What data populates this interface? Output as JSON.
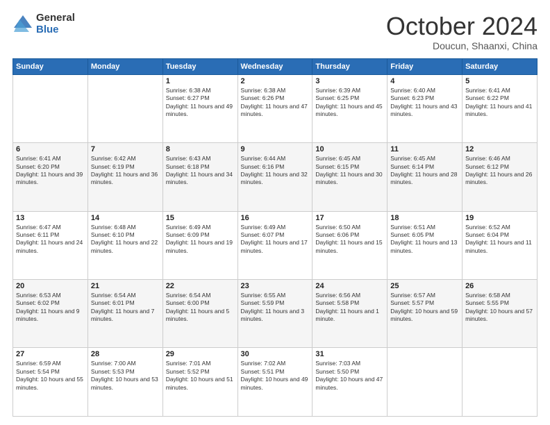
{
  "logo": {
    "general": "General",
    "blue": "Blue"
  },
  "header": {
    "month": "October 2024",
    "location": "Doucun, Shaanxi, China"
  },
  "weekdays": [
    "Sunday",
    "Monday",
    "Tuesday",
    "Wednesday",
    "Thursday",
    "Friday",
    "Saturday"
  ],
  "weeks": [
    [
      {
        "day": "",
        "sunrise": "",
        "sunset": "",
        "daylight": ""
      },
      {
        "day": "",
        "sunrise": "",
        "sunset": "",
        "daylight": ""
      },
      {
        "day": "1",
        "sunrise": "Sunrise: 6:38 AM",
        "sunset": "Sunset: 6:27 PM",
        "daylight": "Daylight: 11 hours and 49 minutes."
      },
      {
        "day": "2",
        "sunrise": "Sunrise: 6:38 AM",
        "sunset": "Sunset: 6:26 PM",
        "daylight": "Daylight: 11 hours and 47 minutes."
      },
      {
        "day": "3",
        "sunrise": "Sunrise: 6:39 AM",
        "sunset": "Sunset: 6:25 PM",
        "daylight": "Daylight: 11 hours and 45 minutes."
      },
      {
        "day": "4",
        "sunrise": "Sunrise: 6:40 AM",
        "sunset": "Sunset: 6:23 PM",
        "daylight": "Daylight: 11 hours and 43 minutes."
      },
      {
        "day": "5",
        "sunrise": "Sunrise: 6:41 AM",
        "sunset": "Sunset: 6:22 PM",
        "daylight": "Daylight: 11 hours and 41 minutes."
      }
    ],
    [
      {
        "day": "6",
        "sunrise": "Sunrise: 6:41 AM",
        "sunset": "Sunset: 6:20 PM",
        "daylight": "Daylight: 11 hours and 39 minutes."
      },
      {
        "day": "7",
        "sunrise": "Sunrise: 6:42 AM",
        "sunset": "Sunset: 6:19 PM",
        "daylight": "Daylight: 11 hours and 36 minutes."
      },
      {
        "day": "8",
        "sunrise": "Sunrise: 6:43 AM",
        "sunset": "Sunset: 6:18 PM",
        "daylight": "Daylight: 11 hours and 34 minutes."
      },
      {
        "day": "9",
        "sunrise": "Sunrise: 6:44 AM",
        "sunset": "Sunset: 6:16 PM",
        "daylight": "Daylight: 11 hours and 32 minutes."
      },
      {
        "day": "10",
        "sunrise": "Sunrise: 6:45 AM",
        "sunset": "Sunset: 6:15 PM",
        "daylight": "Daylight: 11 hours and 30 minutes."
      },
      {
        "day": "11",
        "sunrise": "Sunrise: 6:45 AM",
        "sunset": "Sunset: 6:14 PM",
        "daylight": "Daylight: 11 hours and 28 minutes."
      },
      {
        "day": "12",
        "sunrise": "Sunrise: 6:46 AM",
        "sunset": "Sunset: 6:12 PM",
        "daylight": "Daylight: 11 hours and 26 minutes."
      }
    ],
    [
      {
        "day": "13",
        "sunrise": "Sunrise: 6:47 AM",
        "sunset": "Sunset: 6:11 PM",
        "daylight": "Daylight: 11 hours and 24 minutes."
      },
      {
        "day": "14",
        "sunrise": "Sunrise: 6:48 AM",
        "sunset": "Sunset: 6:10 PM",
        "daylight": "Daylight: 11 hours and 22 minutes."
      },
      {
        "day": "15",
        "sunrise": "Sunrise: 6:49 AM",
        "sunset": "Sunset: 6:09 PM",
        "daylight": "Daylight: 11 hours and 19 minutes."
      },
      {
        "day": "16",
        "sunrise": "Sunrise: 6:49 AM",
        "sunset": "Sunset: 6:07 PM",
        "daylight": "Daylight: 11 hours and 17 minutes."
      },
      {
        "day": "17",
        "sunrise": "Sunrise: 6:50 AM",
        "sunset": "Sunset: 6:06 PM",
        "daylight": "Daylight: 11 hours and 15 minutes."
      },
      {
        "day": "18",
        "sunrise": "Sunrise: 6:51 AM",
        "sunset": "Sunset: 6:05 PM",
        "daylight": "Daylight: 11 hours and 13 minutes."
      },
      {
        "day": "19",
        "sunrise": "Sunrise: 6:52 AM",
        "sunset": "Sunset: 6:04 PM",
        "daylight": "Daylight: 11 hours and 11 minutes."
      }
    ],
    [
      {
        "day": "20",
        "sunrise": "Sunrise: 6:53 AM",
        "sunset": "Sunset: 6:02 PM",
        "daylight": "Daylight: 11 hours and 9 minutes."
      },
      {
        "day": "21",
        "sunrise": "Sunrise: 6:54 AM",
        "sunset": "Sunset: 6:01 PM",
        "daylight": "Daylight: 11 hours and 7 minutes."
      },
      {
        "day": "22",
        "sunrise": "Sunrise: 6:54 AM",
        "sunset": "Sunset: 6:00 PM",
        "daylight": "Daylight: 11 hours and 5 minutes."
      },
      {
        "day": "23",
        "sunrise": "Sunrise: 6:55 AM",
        "sunset": "Sunset: 5:59 PM",
        "daylight": "Daylight: 11 hours and 3 minutes."
      },
      {
        "day": "24",
        "sunrise": "Sunrise: 6:56 AM",
        "sunset": "Sunset: 5:58 PM",
        "daylight": "Daylight: 11 hours and 1 minute."
      },
      {
        "day": "25",
        "sunrise": "Sunrise: 6:57 AM",
        "sunset": "Sunset: 5:57 PM",
        "daylight": "Daylight: 10 hours and 59 minutes."
      },
      {
        "day": "26",
        "sunrise": "Sunrise: 6:58 AM",
        "sunset": "Sunset: 5:55 PM",
        "daylight": "Daylight: 10 hours and 57 minutes."
      }
    ],
    [
      {
        "day": "27",
        "sunrise": "Sunrise: 6:59 AM",
        "sunset": "Sunset: 5:54 PM",
        "daylight": "Daylight: 10 hours and 55 minutes."
      },
      {
        "day": "28",
        "sunrise": "Sunrise: 7:00 AM",
        "sunset": "Sunset: 5:53 PM",
        "daylight": "Daylight: 10 hours and 53 minutes."
      },
      {
        "day": "29",
        "sunrise": "Sunrise: 7:01 AM",
        "sunset": "Sunset: 5:52 PM",
        "daylight": "Daylight: 10 hours and 51 minutes."
      },
      {
        "day": "30",
        "sunrise": "Sunrise: 7:02 AM",
        "sunset": "Sunset: 5:51 PM",
        "daylight": "Daylight: 10 hours and 49 minutes."
      },
      {
        "day": "31",
        "sunrise": "Sunrise: 7:03 AM",
        "sunset": "Sunset: 5:50 PM",
        "daylight": "Daylight: 10 hours and 47 minutes."
      },
      {
        "day": "",
        "sunrise": "",
        "sunset": "",
        "daylight": ""
      },
      {
        "day": "",
        "sunrise": "",
        "sunset": "",
        "daylight": ""
      }
    ]
  ]
}
